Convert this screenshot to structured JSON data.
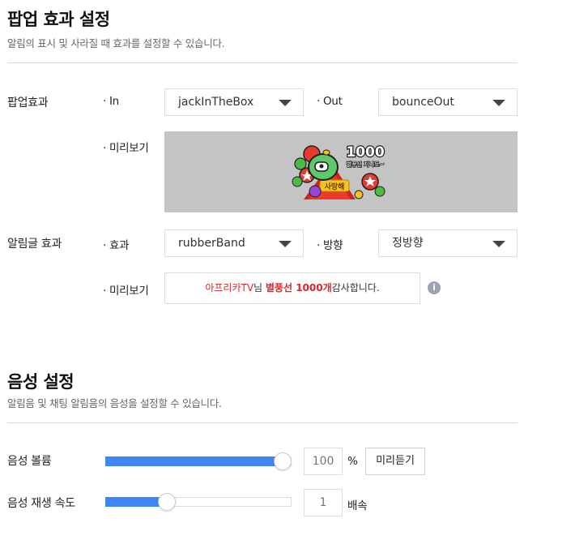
{
  "popup_section": {
    "title": "팝업 효과 설정",
    "description": "알림의 표시 및 사라질 때 효과를 설정할 수 있습니다."
  },
  "popup_effect": {
    "label": "팝업효과",
    "in_label": "· In",
    "in_value": "jackInTheBox",
    "out_label": "· Out",
    "out_value": "bounceOut",
    "preview_label": "· 미리보기",
    "image_badge": "1000",
    "image_badge_sub": "별풍선 지나도~",
    "image_caption": "사랑해"
  },
  "text_effect": {
    "label": "알림글 효과",
    "effect_label": "· 효과",
    "effect_value": "rubberBand",
    "direction_label": "· 방향",
    "direction_value": "정방향",
    "preview_label": "· 미리보기",
    "preview_name": "아프리카TV",
    "preview_honorific": "님 ",
    "preview_gift": "별풍선 1000개",
    "preview_suffix": "감사합니다.",
    "info_glyph": "i"
  },
  "voice_section": {
    "title": "음성 설정",
    "description": "알림음 및 채팅 알림음의 음성을 설정할 수 있습니다."
  },
  "voice_volume": {
    "label": "음성 볼륨",
    "value": "100",
    "fraction": 1.0,
    "unit": "%",
    "button_label": "미리듣기"
  },
  "voice_speed": {
    "label": "음성 재생 속도",
    "value": "1",
    "fraction": 0.33,
    "unit": "배속"
  },
  "colors": {
    "accent": "#3f85f4",
    "track": "#e6e6e6",
    "highlight_red": "#e0242a"
  }
}
